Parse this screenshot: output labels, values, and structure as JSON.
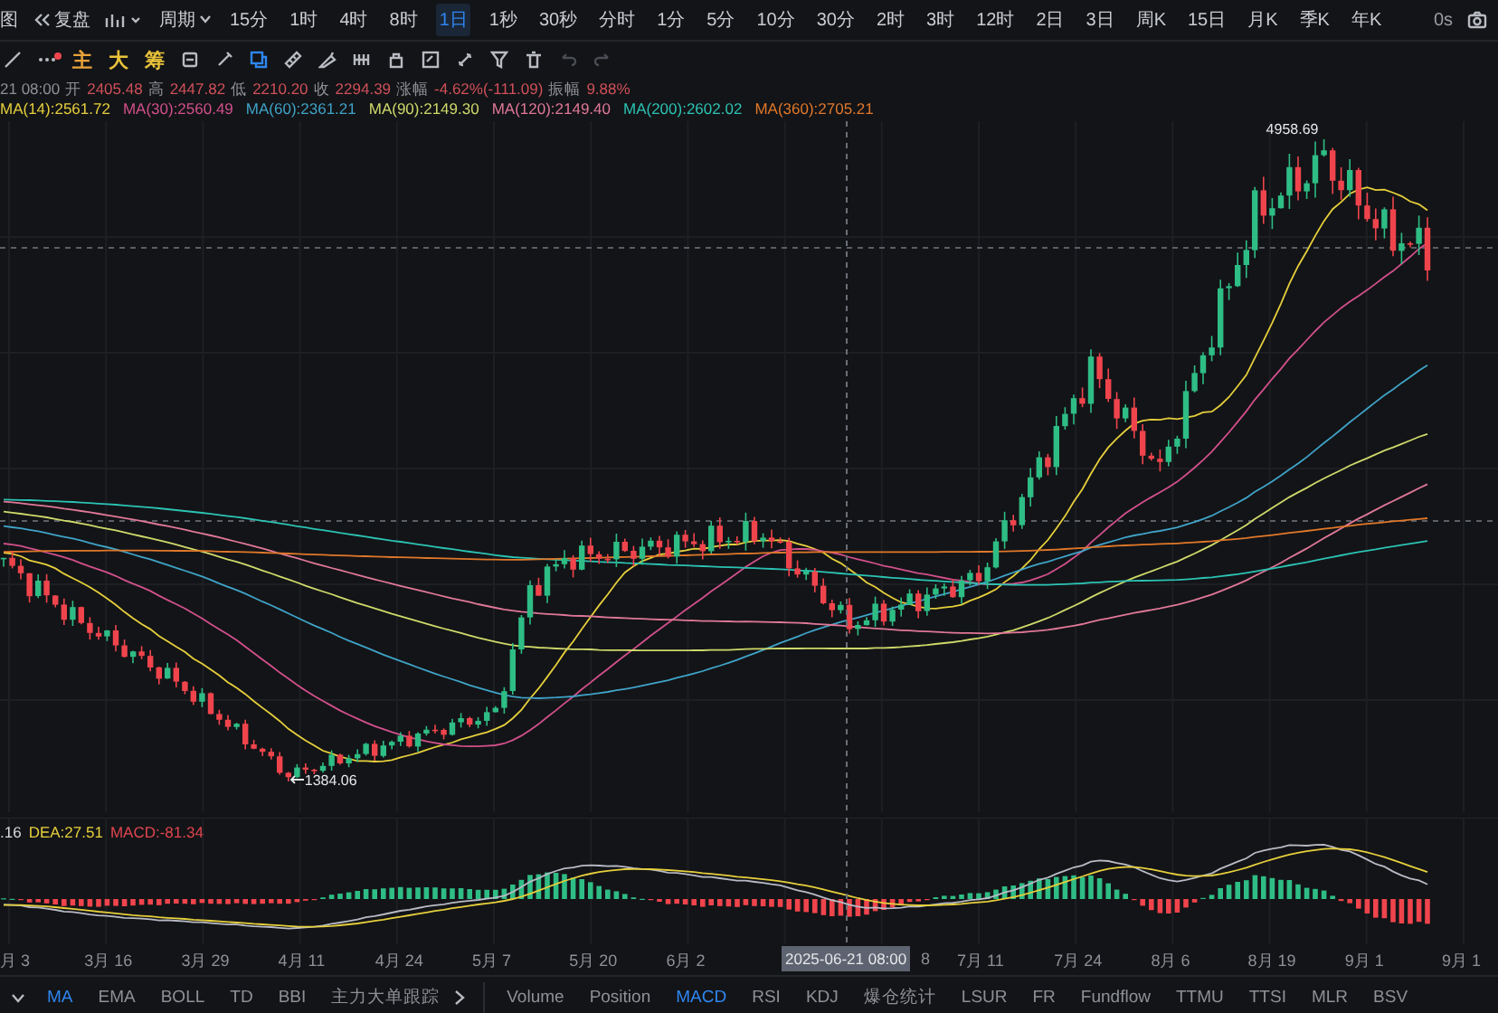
{
  "top_bar": {
    "cut_label": "图",
    "replay": "复盘",
    "period": "周期",
    "intervals": [
      {
        "label": "15分",
        "selected": false
      },
      {
        "label": "1时",
        "selected": false
      },
      {
        "label": "4时",
        "selected": false
      },
      {
        "label": "8时",
        "selected": false
      },
      {
        "label": "1日",
        "selected": true
      },
      {
        "label": "1秒",
        "selected": false
      },
      {
        "label": "30秒",
        "selected": false
      },
      {
        "label": "分时",
        "selected": false
      },
      {
        "label": "1分",
        "selected": false
      },
      {
        "label": "5分",
        "selected": false
      },
      {
        "label": "10分",
        "selected": false
      },
      {
        "label": "30分",
        "selected": false
      },
      {
        "label": "2时",
        "selected": false
      },
      {
        "label": "3时",
        "selected": false
      },
      {
        "label": "12时",
        "selected": false
      },
      {
        "label": "2日",
        "selected": false
      },
      {
        "label": "3日",
        "selected": false
      },
      {
        "label": "周K",
        "selected": false
      },
      {
        "label": "15日",
        "selected": false
      },
      {
        "label": "月K",
        "selected": false
      },
      {
        "label": "季K",
        "selected": false
      },
      {
        "label": "年K",
        "selected": false
      }
    ],
    "refresh": "0s"
  },
  "tool_bar": {
    "chips": [
      {
        "label": "主",
        "color": "#e8a33a"
      },
      {
        "label": "大",
        "color": "#e8c23a"
      },
      {
        "label": "筹",
        "color": "#e8c23a"
      }
    ]
  },
  "info": {
    "date": "21 08:00",
    "fields": [
      {
        "label": "开",
        "value": "2405.48"
      },
      {
        "label": "高",
        "value": "2447.82"
      },
      {
        "label": "低",
        "value": "2210.20"
      },
      {
        "label": "收",
        "value": "2294.39"
      },
      {
        "label": "涨幅",
        "value": "-4.62%(-111.09)"
      },
      {
        "label": "振幅",
        "value": "9.88%"
      }
    ]
  },
  "moving_averages": [
    {
      "label": "MA(14):2561.72",
      "color": "#e6cf3c"
    },
    {
      "label": "MA(30):2560.49",
      "color": "#d2508c"
    },
    {
      "label": "MA(60):2361.21",
      "color": "#3fa3c8"
    },
    {
      "label": "MA(90):2149.30",
      "color": "#cfd96a"
    },
    {
      "label": "MA(120):2149.40",
      "color": "#e07898"
    },
    {
      "label": "MA(200):2602.02",
      "color": "#2bc3b4"
    },
    {
      "label": "MA(360):2705.21",
      "color": "#e0782a"
    }
  ],
  "price_chart": {
    "high_label": "4958.69",
    "low_label": "1384.06"
  },
  "macd": {
    "values": [
      {
        "label": ".16",
        "color": "#d9dbdf"
      },
      {
        "label": "DEA:27.51",
        "color": "#e6cf3c"
      },
      {
        "label": "MACD:-81.34",
        "color": "#e0454f"
      }
    ]
  },
  "x_axis": {
    "ticks": [
      {
        "label": "月 3",
        "kind": "tick"
      },
      {
        "label": "3月 16",
        "kind": "tick"
      },
      {
        "label": "3月 29",
        "kind": "tick"
      },
      {
        "label": "4月 11",
        "kind": "tick"
      },
      {
        "label": "4月 24",
        "kind": "tick"
      },
      {
        "label": "5月 7",
        "kind": "tick"
      },
      {
        "label": "5月 20",
        "kind": "tick"
      },
      {
        "label": "6月 2",
        "kind": "tick"
      },
      {
        "label": "8",
        "kind": "partial"
      },
      {
        "label": "7月 11",
        "kind": "tick"
      },
      {
        "label": "7月 24",
        "kind": "tick"
      },
      {
        "label": "8月 6",
        "kind": "tick"
      },
      {
        "label": "8月 19",
        "kind": "tick"
      },
      {
        "label": "9月 1",
        "kind": "tick"
      },
      {
        "label": "9月 1",
        "kind": "tick"
      }
    ],
    "cursor_label": "2025-06-21 08:00"
  },
  "indicator_tabs": {
    "main": [
      {
        "label": "MA",
        "selected": true
      },
      {
        "label": "EMA",
        "selected": false
      },
      {
        "label": "BOLL",
        "selected": false
      },
      {
        "label": "TD",
        "selected": false
      },
      {
        "label": "BBI",
        "selected": false
      },
      {
        "label": "主力大单跟踪",
        "selected": false
      }
    ],
    "sub": [
      {
        "label": "Volume",
        "selected": false
      },
      {
        "label": "Position",
        "selected": false
      },
      {
        "label": "MACD",
        "selected": true
      },
      {
        "label": "RSI",
        "selected": false
      },
      {
        "label": "KDJ",
        "selected": false
      },
      {
        "label": "爆仓统计",
        "selected": false
      },
      {
        "label": "LSUR",
        "selected": false
      },
      {
        "label": "FR",
        "selected": false
      },
      {
        "label": "Fundflow",
        "selected": false
      },
      {
        "label": "TTMU",
        "selected": false
      },
      {
        "label": "TTSI",
        "selected": false
      },
      {
        "label": "MLR",
        "selected": false
      },
      {
        "label": "BSV",
        "selected": false
      }
    ]
  }
}
